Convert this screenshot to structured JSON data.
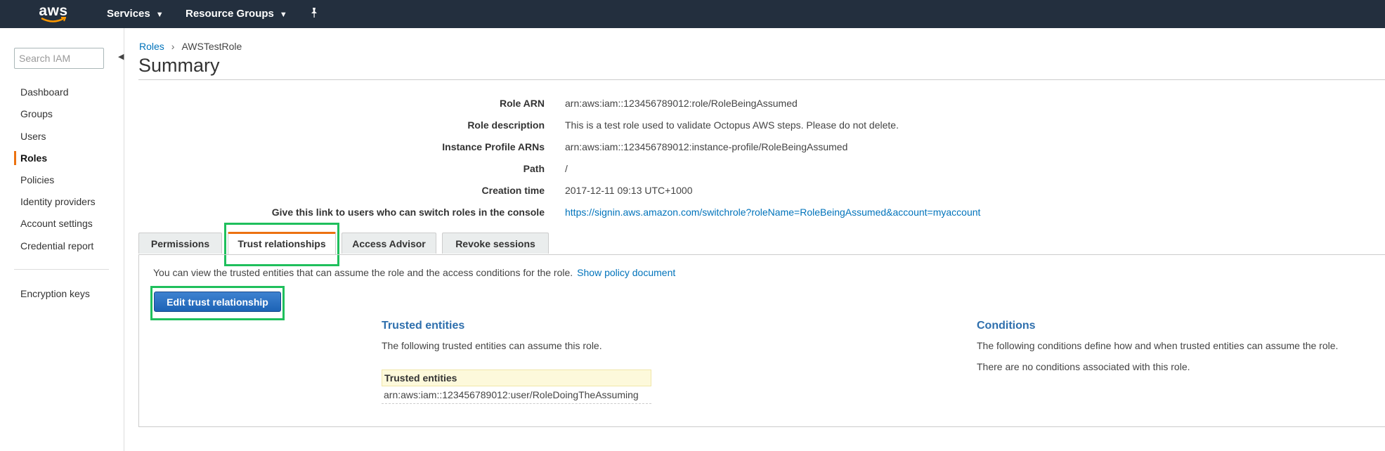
{
  "nav": {
    "logo": "aws",
    "services": "Services",
    "resource_groups": "Resource Groups"
  },
  "sidebar": {
    "search_placeholder": "Search IAM",
    "items": [
      {
        "label": "Dashboard"
      },
      {
        "label": "Groups"
      },
      {
        "label": "Users"
      },
      {
        "label": "Roles",
        "active": true
      },
      {
        "label": "Policies"
      },
      {
        "label": "Identity providers"
      },
      {
        "label": "Account settings"
      },
      {
        "label": "Credential report"
      }
    ],
    "extra_item": "Encryption keys"
  },
  "breadcrumb": {
    "parent": "Roles",
    "current": "AWSTestRole"
  },
  "title": "Summary",
  "summary": {
    "rows": [
      {
        "label": "Role ARN",
        "value": "arn:aws:iam::123456789012:role/RoleBeingAssumed"
      },
      {
        "label": "Role description",
        "value": "This is a test role used to validate Octopus AWS steps. Please do not delete."
      },
      {
        "label": "Instance Profile ARNs",
        "value": "arn:aws:iam::123456789012:instance-profile/RoleBeingAssumed"
      },
      {
        "label": "Path",
        "value": "/"
      },
      {
        "label": "Creation time",
        "value": "2017-12-11 09:13 UTC+1000"
      },
      {
        "label": "Give this link to users who can switch roles in the console",
        "value": "https://signin.aws.amazon.com/switchrole?roleName=RoleBeingAssumed&account=myaccount"
      }
    ]
  },
  "tabs": [
    {
      "label": "Permissions"
    },
    {
      "label": "Trust relationships",
      "active": true
    },
    {
      "label": "Access Advisor"
    },
    {
      "label": "Revoke sessions"
    }
  ],
  "trust": {
    "intro": "You can view the trusted entities that can assume the role and the access conditions for the role.",
    "show_policy": "Show policy document",
    "edit_button": "Edit trust relationship",
    "entities_heading": "Trusted entities",
    "entities_desc": "The following trusted entities can assume this role.",
    "table_header": "Trusted entities",
    "table_rows": [
      "arn:aws:iam::123456789012:user/RoleDoingTheAssuming"
    ],
    "conditions_heading": "Conditions",
    "conditions_desc": "The following conditions define how and when trusted entities can assume the role.",
    "conditions_none": "There are no conditions associated with this role."
  },
  "colors": {
    "nav_bg": "#232f3e",
    "accent": "#ec7211",
    "link": "#0073bb",
    "highlight": "#1fbf5c",
    "button": "#1d63b6"
  }
}
